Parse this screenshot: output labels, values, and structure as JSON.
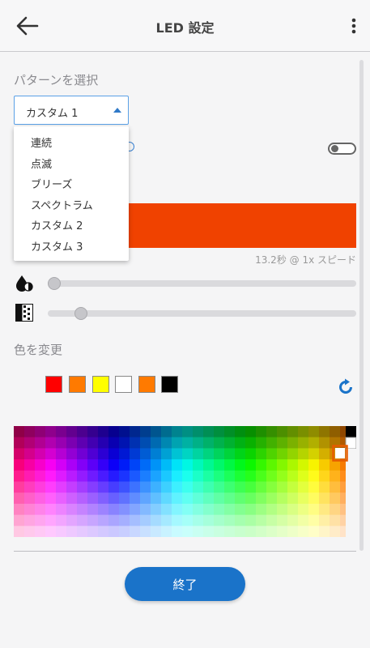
{
  "header": {
    "title": "LED 設定",
    "back_icon": "arrow-left-icon",
    "menu_icon": "more-vertical-icon"
  },
  "pattern": {
    "section_label": "パターンを選択",
    "selected": "カスタム 1",
    "options": [
      "連続",
      "点滅",
      "ブリーズ",
      "スペクトラム",
      "カスタム 2",
      "カスタム 3"
    ]
  },
  "toggle": {
    "on": false
  },
  "preview": {
    "color": "#f04200",
    "speed_text": "13.2秒 @ 1x スピード"
  },
  "sliders": {
    "brightness": {
      "icon": "brightness-drop-icon",
      "value": 0.0
    },
    "transparency": {
      "icon": "transparency-pattern-icon",
      "value": 0.09
    }
  },
  "colors": {
    "section_label": "色を変更",
    "swatches": [
      "#ff0000",
      "#ff7a00",
      "#ffff00",
      "#ffffff",
      "#ff7a00",
      "#000000"
    ],
    "reset_icon": "refresh-icon"
  },
  "footer": {
    "done_label": "終了"
  }
}
